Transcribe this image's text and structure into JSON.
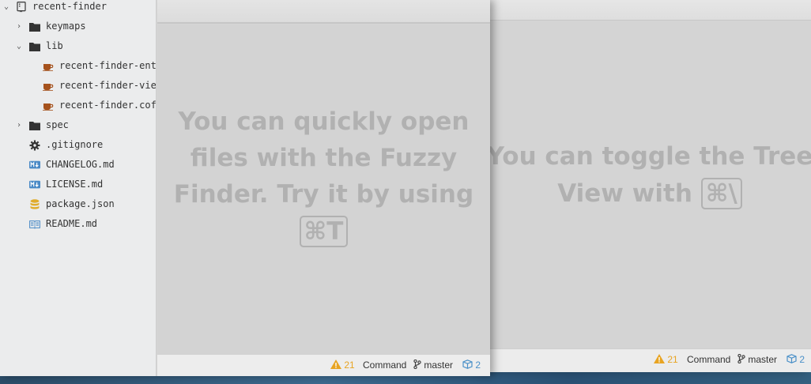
{
  "tree": {
    "root": "recent-finder",
    "items": [
      {
        "label": "keymaps",
        "kind": "folder",
        "expanded": false
      },
      {
        "label": "lib",
        "kind": "folder",
        "expanded": true
      },
      {
        "label": "recent-finder-entr",
        "kind": "coffee"
      },
      {
        "label": "recent-finder-view",
        "kind": "coffee"
      },
      {
        "label": "recent-finder.coff",
        "kind": "coffee"
      },
      {
        "label": "spec",
        "kind": "folder",
        "expanded": false
      },
      {
        "label": ".gitignore",
        "kind": "gear"
      },
      {
        "label": "CHANGELOG.md",
        "kind": "markdown"
      },
      {
        "label": "LICENSE.md",
        "kind": "markdown"
      },
      {
        "label": "package.json",
        "kind": "json"
      },
      {
        "label": "README.md",
        "kind": "readme"
      }
    ]
  },
  "front": {
    "hint_text": "You can quickly open files with the Fuzzy Finder. Try it by using",
    "hint_key": "⌘T"
  },
  "back": {
    "hint_text": "You can toggle the Tree View with",
    "hint_key": "⌘\\"
  },
  "status_front": {
    "warnings": "21",
    "mode": "Command",
    "branch": "master",
    "packages": "2"
  },
  "status_back": {
    "warnings": "21",
    "mode": "Command",
    "branch": "master",
    "packages": "2"
  },
  "colors": {
    "warning": "#e8a422",
    "package": "#4a90c8",
    "coffee": "#a5521d",
    "markdown": "#4a8ac6",
    "json": "#e0ac2c"
  }
}
